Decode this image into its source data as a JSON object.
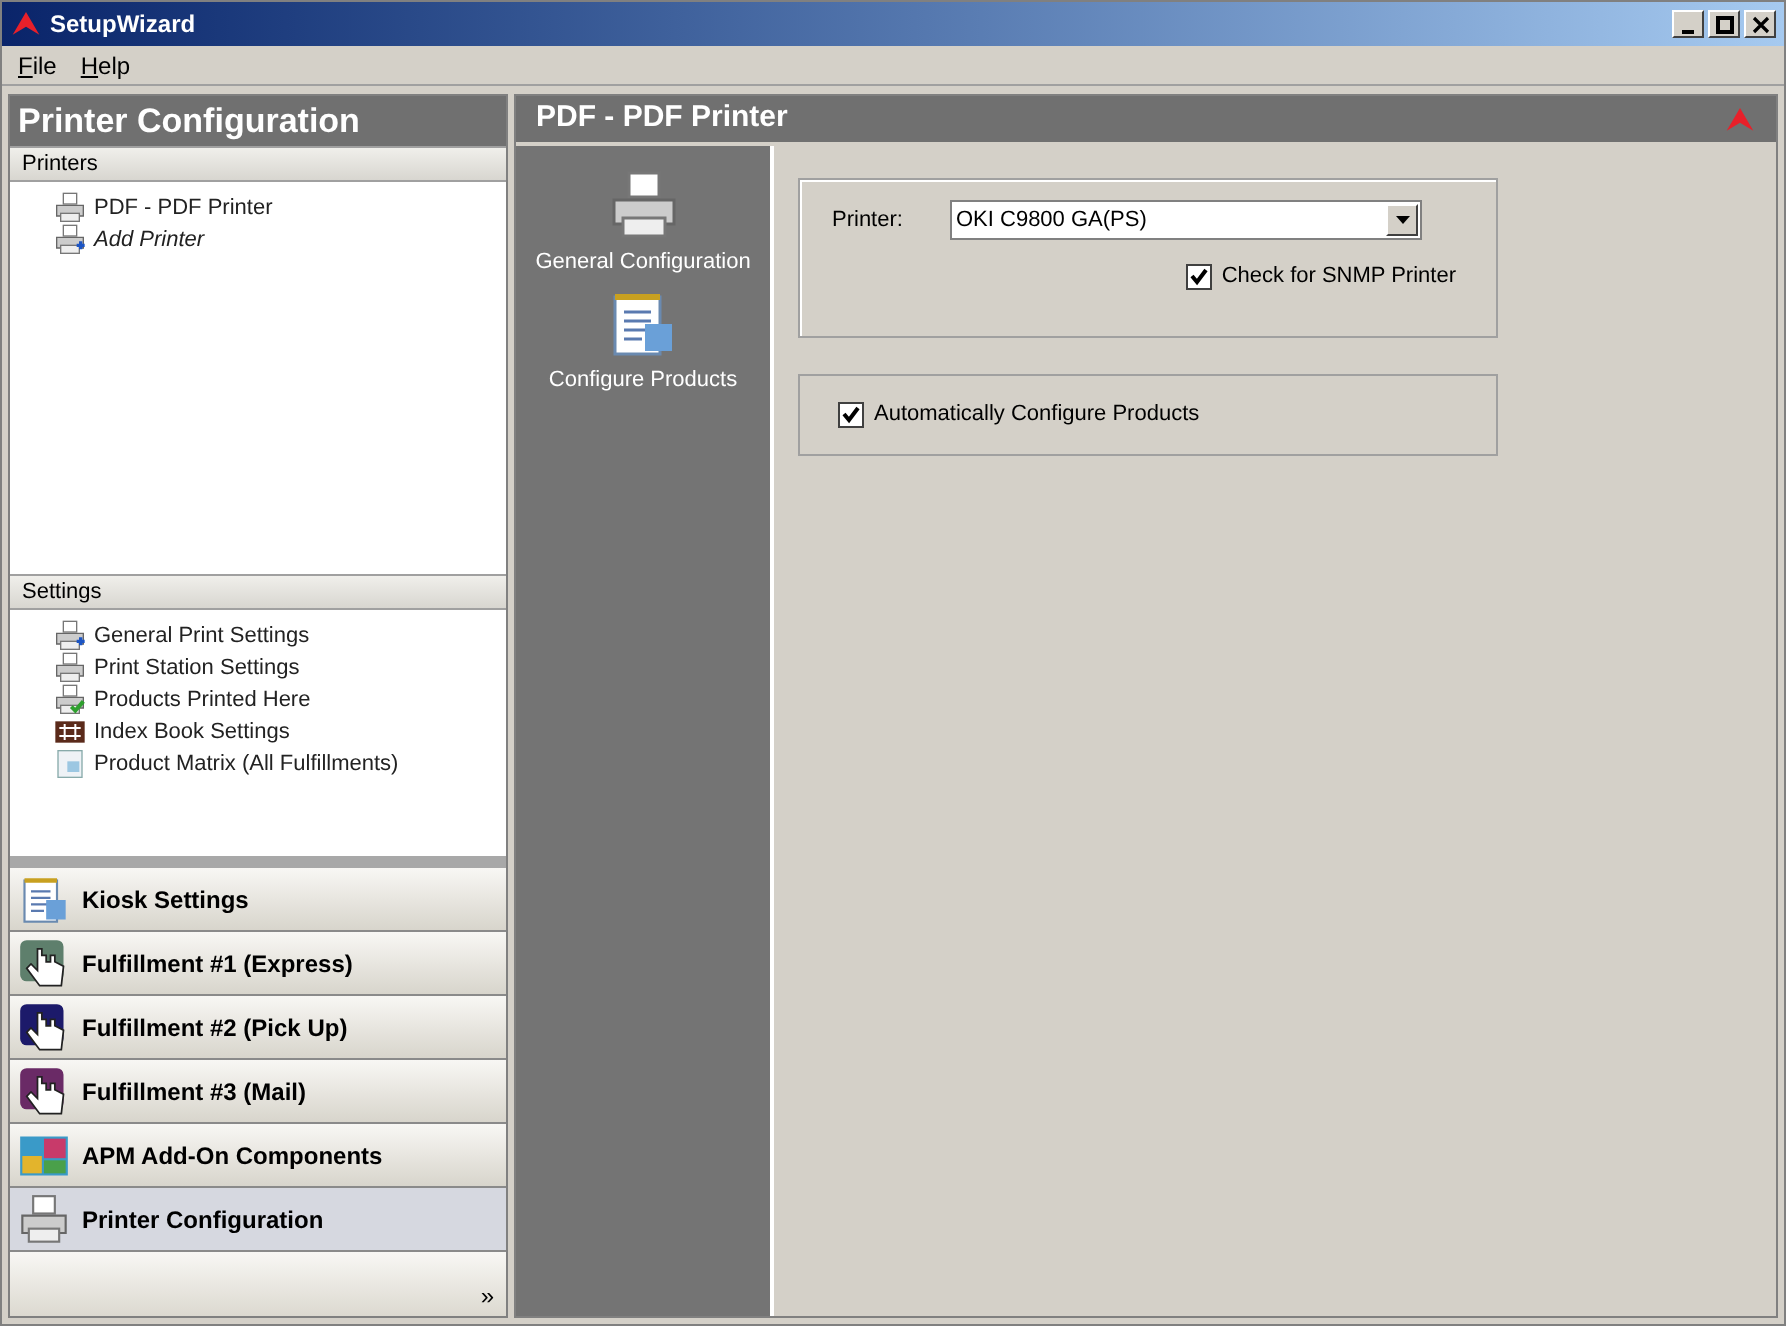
{
  "window": {
    "title": "SetupWizard"
  },
  "menu": [
    {
      "label": "File"
    },
    {
      "label": "Help"
    }
  ],
  "left_panel": {
    "title": "Printer Configuration",
    "sections": [
      {
        "title": "Printers",
        "items": [
          {
            "label": "PDF - PDF Printer",
            "kind": "printer",
            "italic": false
          },
          {
            "label": "Add Printer",
            "kind": "printer-add",
            "italic": true
          }
        ]
      },
      {
        "title": "Settings",
        "items": [
          {
            "label": "General Print Settings",
            "kind": "printer-add",
            "italic": false
          },
          {
            "label": "Print Station Settings",
            "kind": "printer",
            "italic": false
          },
          {
            "label": "Products Printed Here",
            "kind": "printer-check",
            "italic": false
          },
          {
            "label": "Index Book Settings",
            "kind": "grid",
            "italic": false
          },
          {
            "label": "Product Matrix (All Fulfillments)",
            "kind": "sheet",
            "italic": false
          }
        ]
      }
    ],
    "nav_buttons": [
      {
        "label": "Kiosk Settings",
        "kind": "notepad",
        "selected": false
      },
      {
        "label": "Fulfillment #1 (Express)",
        "kind": "hand",
        "color": "#5e7f6c",
        "selected": false
      },
      {
        "label": "Fulfillment #2 (Pick Up)",
        "kind": "hand",
        "color": "#1c1a6a",
        "selected": false
      },
      {
        "label": "Fulfillment #3 (Mail)",
        "kind": "hand",
        "color": "#6a2a66",
        "selected": false
      },
      {
        "label": "APM Add-On Components",
        "kind": "collage",
        "selected": false
      },
      {
        "label": "Printer Configuration",
        "kind": "printer",
        "selected": true
      }
    ],
    "overflow": "»"
  },
  "right_panel": {
    "title": "PDF - PDF Printer",
    "side_nav": [
      {
        "label": "General Configuration",
        "kind": "printer"
      },
      {
        "label": "Configure Products",
        "kind": "notepad"
      }
    ],
    "printer_group": {
      "label": "Printer:",
      "value": "OKI C9800 GA(PS)",
      "snmp": {
        "label": "Check for SNMP Printer",
        "checked": true
      }
    },
    "auto_group": {
      "label": "Automatically Configure Products",
      "checked": true
    }
  }
}
